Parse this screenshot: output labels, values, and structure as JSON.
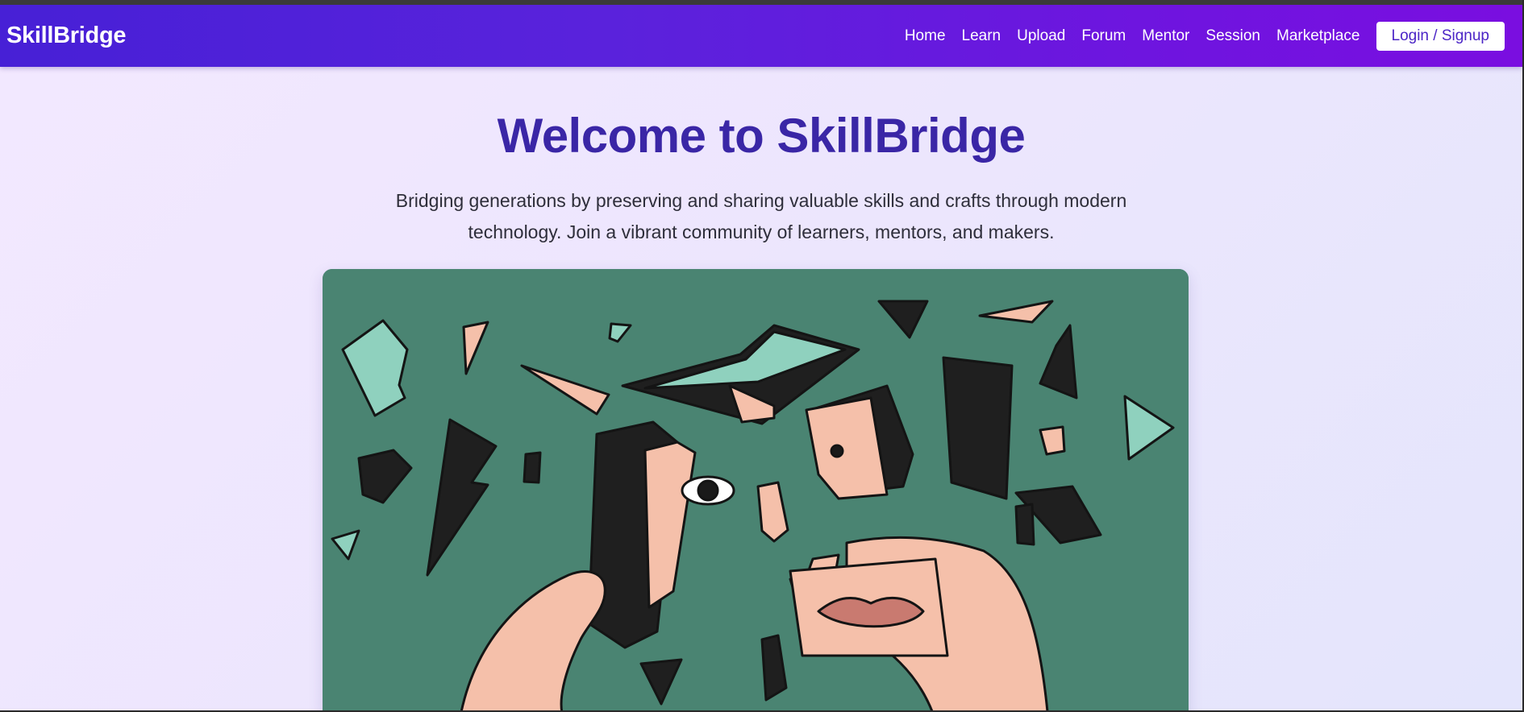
{
  "navbar": {
    "logo": "SkillBridge",
    "links": [
      "Home",
      "Learn",
      "Upload",
      "Forum",
      "Mentor",
      "Session",
      "Marketplace"
    ],
    "login_label": "Login / Signup"
  },
  "hero": {
    "title": "Welcome to SkillBridge",
    "description": "Bridging generations by preserving and sharing valuable skills and crafts through modern technology. Join a vibrant community of learners, mentors, and makers."
  },
  "colors": {
    "nav_gradient_start": "#4720d6",
    "nav_gradient_end": "#7a0ee0",
    "title": "#3a26a6",
    "illustration_bg": "#4a8472",
    "shard_mint": "#8fd1be",
    "shard_skin": "#f5c0aa",
    "shard_dark": "#1f1f1f"
  }
}
